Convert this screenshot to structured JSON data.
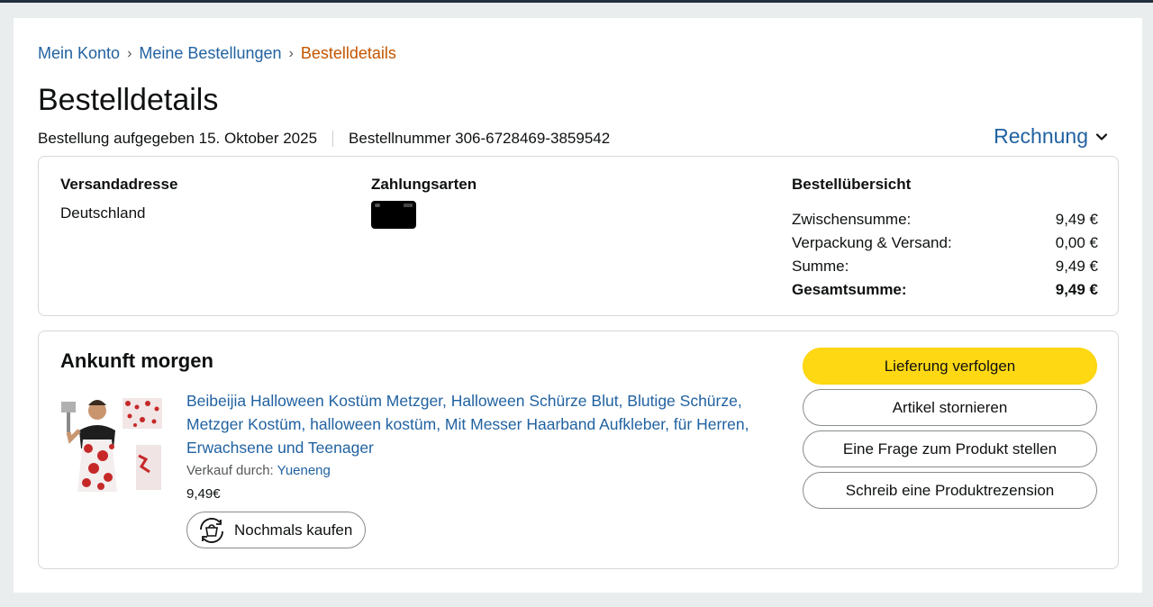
{
  "breadcrumb": {
    "items": [
      "Mein Konto",
      "Meine Bestellungen"
    ],
    "current": "Bestelldetails",
    "separator": "›"
  },
  "page_title": "Bestelldetails",
  "order_meta": {
    "placed": "Bestellung aufgegeben 15. Oktober 2025",
    "number": "Bestellnummer 306-6728469-3859542"
  },
  "invoice_label": "Rechnung",
  "shipping": {
    "heading": "Versandadresse",
    "value": "Deutschland"
  },
  "payment": {
    "heading": "Zahlungsarten",
    "card_icon": "payment-card-icon"
  },
  "summary": {
    "heading": "Bestellübersicht",
    "rows": [
      {
        "label": "Zwischensumme:",
        "value": "9,49 €"
      },
      {
        "label": "Verpackung & Versand:",
        "value": "0,00 €"
      },
      {
        "label": "Summe:",
        "value": "9,49 €"
      },
      {
        "label": "Gesamtsumme:",
        "value": "9,49 €"
      }
    ]
  },
  "shipment": {
    "status": "Ankunft morgen",
    "product_title": "Beibeijia Halloween Kostüm Metzger, Halloween Schürze Blut, Blutige Schürze, Metzger Kostüm, halloween kostüm, Mit Messer Haarband Aufkleber, für Herren, Erwachsene und Teenager",
    "sold_by_label": "Verkauf durch:",
    "seller": "Yueneng",
    "price": "9,49€",
    "buy_again": "Nochmals kaufen"
  },
  "actions": {
    "track": "Lieferung verfolgen",
    "cancel": "Artikel stornieren",
    "question": "Eine Frage zum Produkt stellen",
    "review": "Schreib eine Produktrezension"
  },
  "colors": {
    "link": "#2162a1",
    "breadcrumb_current": "#c45500",
    "primary_button": "#ffd814",
    "background": "#eaeded"
  }
}
